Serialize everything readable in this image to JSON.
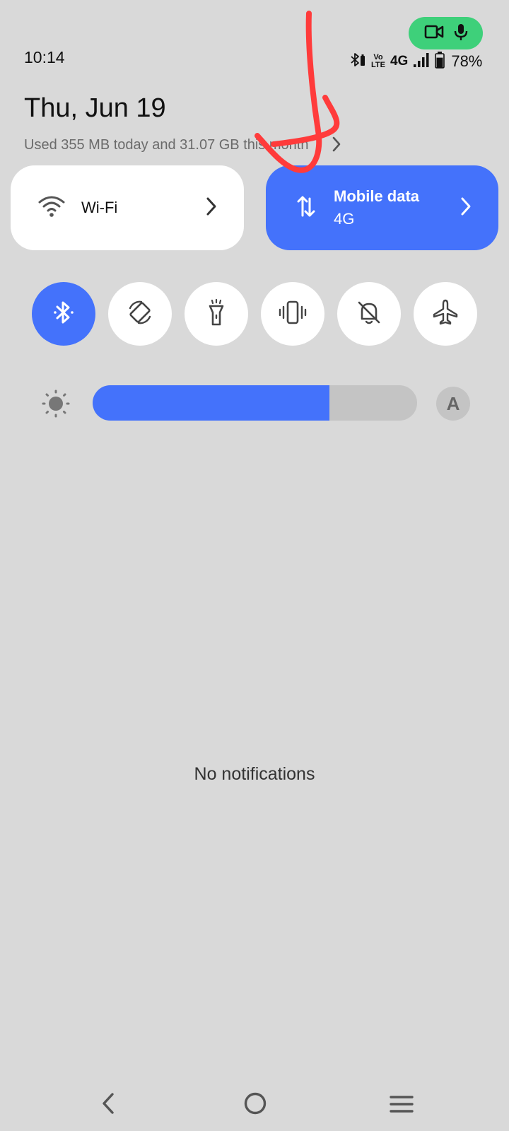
{
  "status_bar": {
    "time": "10:14",
    "network_text": "4G",
    "volte_line1": "Vo",
    "volte_line2": "LTE",
    "battery_percent": "78%",
    "battery_level_percent": 78,
    "icons": [
      "bluetooth-battery-icon",
      "volte-icon",
      "signal-icon",
      "battery-icon",
      "video-camera-icon",
      "microphone-icon"
    ]
  },
  "header": {
    "date": "Thu, Jun 19",
    "data_usage": "Used 355 MB today and 31.07 GB this month"
  },
  "tiles": {
    "wifi": {
      "label": "Wi-Fi",
      "icon": "wifi-icon"
    },
    "mobile_data": {
      "label": "Mobile data",
      "sublabel": "4G",
      "icon": "data-arrows-icon"
    }
  },
  "toggles": [
    {
      "name": "bluetooth",
      "icon": "bluetooth-icon",
      "active": true
    },
    {
      "name": "auto-rotate",
      "icon": "auto-rotate-icon",
      "active": false
    },
    {
      "name": "flashlight",
      "icon": "flashlight-icon",
      "active": false
    },
    {
      "name": "vibrate",
      "icon": "vibrate-icon",
      "active": false
    },
    {
      "name": "do-not-disturb",
      "icon": "bell-off-icon",
      "active": false
    },
    {
      "name": "airplane-mode",
      "icon": "airplane-icon",
      "active": false
    }
  ],
  "brightness": {
    "level_percent": 73,
    "auto_label": "A"
  },
  "notifications": {
    "empty_text": "No notifications"
  },
  "colors": {
    "accent": "#4472fb",
    "background": "#d9d9d9",
    "tile_light": "#ffffff",
    "camera_pill": "#3ed07a",
    "annotation": "#ff3b3b"
  }
}
